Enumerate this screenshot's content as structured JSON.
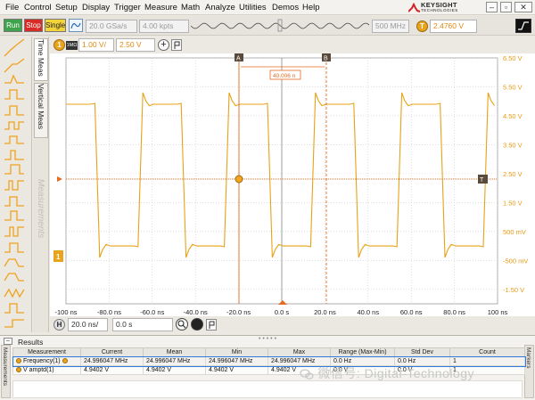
{
  "menu": [
    "File",
    "Control",
    "Setup",
    "Display",
    "Trigger",
    "Measure",
    "Math",
    "Analyze",
    "Utilities",
    "Demos",
    "Help"
  ],
  "brand": {
    "name": "KEYSIGHT",
    "sub": "TECHNOLOGIES"
  },
  "toolbar": {
    "run_label": "Run",
    "stop_label": "Stop",
    "single_label": "Single",
    "sample_rate": "20.0 GSa/s",
    "memory_depth": "4.00 kpts",
    "bandwidth": "500 MHz",
    "trigger_badge": "T",
    "trigger_level": "2.4760 V"
  },
  "channel": {
    "number": "1",
    "coupling": "1MΩ",
    "scale": "1.00 V/",
    "offset": "2.50 V"
  },
  "tabs": {
    "time_meas": "Time Meas",
    "vertical_meas": "Vertical Meas",
    "measurements": "Measurements"
  },
  "scope": {
    "marker_a": "A",
    "marker_b": "B",
    "delta_readout": "40.006 n",
    "ch_marker": "1",
    "trig_marker": "T"
  },
  "chart_data": {
    "type": "line",
    "title": "",
    "xlabel": "",
    "ylabel": "",
    "x_ticks": [
      "-100 ns",
      "-80.0 ns",
      "-60.0 ns",
      "-40.0 ns",
      "-20.0 ns",
      "0.0 s",
      "20.0 ns",
      "40.0 ns",
      "60.0 ns",
      "80.0 ns",
      "100 ns"
    ],
    "y_ticks": [
      "6.50 V",
      "5.50 V",
      "4.50 V",
      "3.50 V",
      "2.50 V",
      "1.50 V",
      "500 mV",
      "-500 mV",
      "-1.50 V"
    ],
    "xlim": [
      -100,
      100
    ],
    "ylim": [
      -2.0,
      6.5
    ],
    "grid": true,
    "series": [
      {
        "shape": "square",
        "period_ns": 40.0,
        "high_V": 4.9,
        "low_V": 0.0,
        "overshoot_V": 0.4,
        "first_fall_ns": -86
      }
    ],
    "colors": {
      "trace": "#e8a217",
      "grid": "#c9c9c9",
      "cursor": "#e56b1f"
    }
  },
  "horizontal": {
    "badge": "H",
    "scale": "20.0 ns/",
    "position": "0.0 s"
  },
  "results": {
    "title": "Results",
    "side_left": "Measurements",
    "side_right": "Markers",
    "headers": [
      "Measurement",
      "Current",
      "Mean",
      "Min",
      "Max",
      "Range (Max-Min)",
      "Std Dev",
      "Count"
    ],
    "rows": [
      [
        "Frequency(1)",
        "24.996047 MHz",
        "24.996047 MHz",
        "24.996047 MHz",
        "24.996047 MHz",
        "0.0 Hz",
        "0.0 Hz",
        "1"
      ],
      [
        "V amptd(1)",
        "4.9402 V",
        "4.9402 V",
        "4.9402 V",
        "4.9402 V",
        "0.0 V",
        "0.0 V",
        "1"
      ]
    ]
  },
  "watermark": "微信号: Digital-Technology"
}
